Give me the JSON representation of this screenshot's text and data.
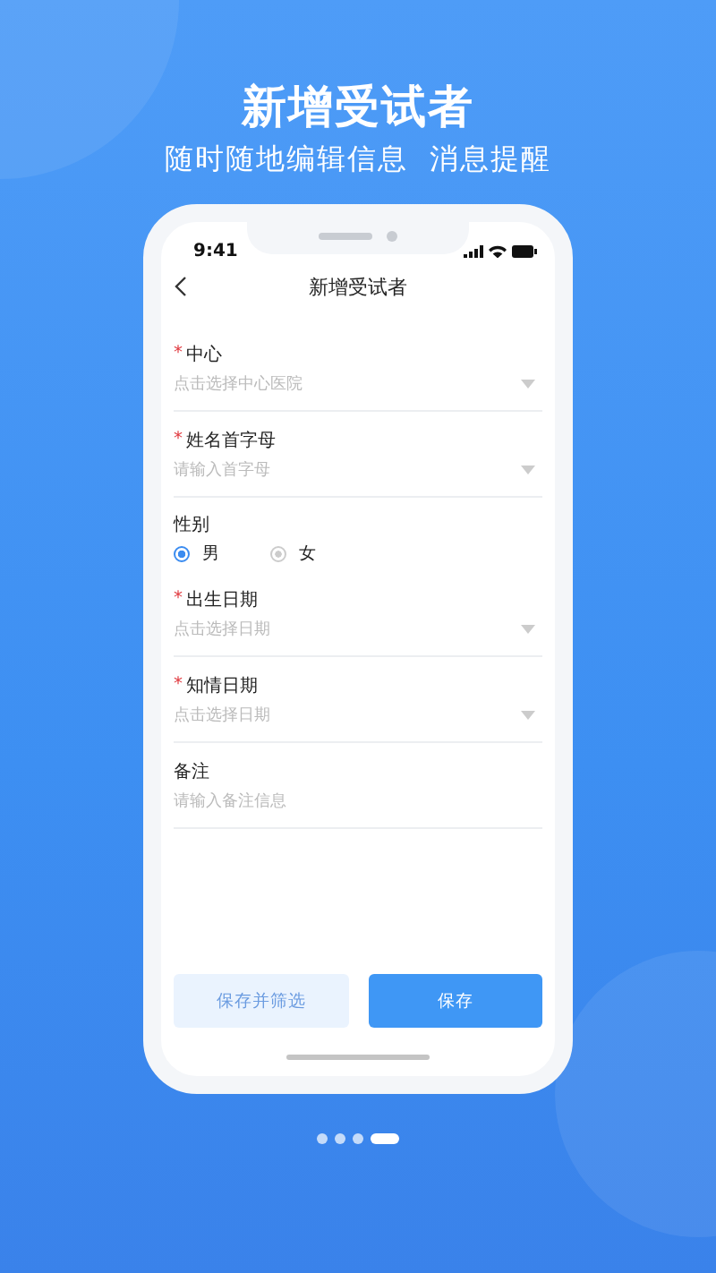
{
  "headline": "新增受试者",
  "subheadline": "随时随地编辑信息  消息提醒",
  "status_bar": {
    "time": "9:41"
  },
  "nav": {
    "title": "新增受试者"
  },
  "fields": [
    {
      "kind": "select",
      "required_mark": "*",
      "label": "中心",
      "placeholder": "点击选择中心医院"
    },
    {
      "kind": "select",
      "required_mark": "*",
      "label": "姓名首字母",
      "placeholder": "请输入首字母"
    },
    {
      "kind": "radio",
      "label": "性别",
      "options": [
        {
          "label": "男",
          "selected": true
        },
        {
          "label": "女",
          "selected": false
        }
      ]
    },
    {
      "kind": "select",
      "required_mark": "*",
      "label": "出生日期",
      "placeholder": "点击选择日期"
    },
    {
      "kind": "select",
      "required_mark": "*",
      "label": "知情日期",
      "placeholder": "点击选择日期"
    },
    {
      "kind": "text",
      "label": "备注",
      "placeholder": "请输入备注信息"
    }
  ],
  "buttons": [
    {
      "label": "保存并筛选",
      "kind": "secondary"
    },
    {
      "label": "保存",
      "kind": "primary"
    }
  ],
  "pager": [
    {
      "selected": false
    },
    {
      "selected": false
    },
    {
      "selected": false
    },
    {
      "selected": true
    }
  ]
}
